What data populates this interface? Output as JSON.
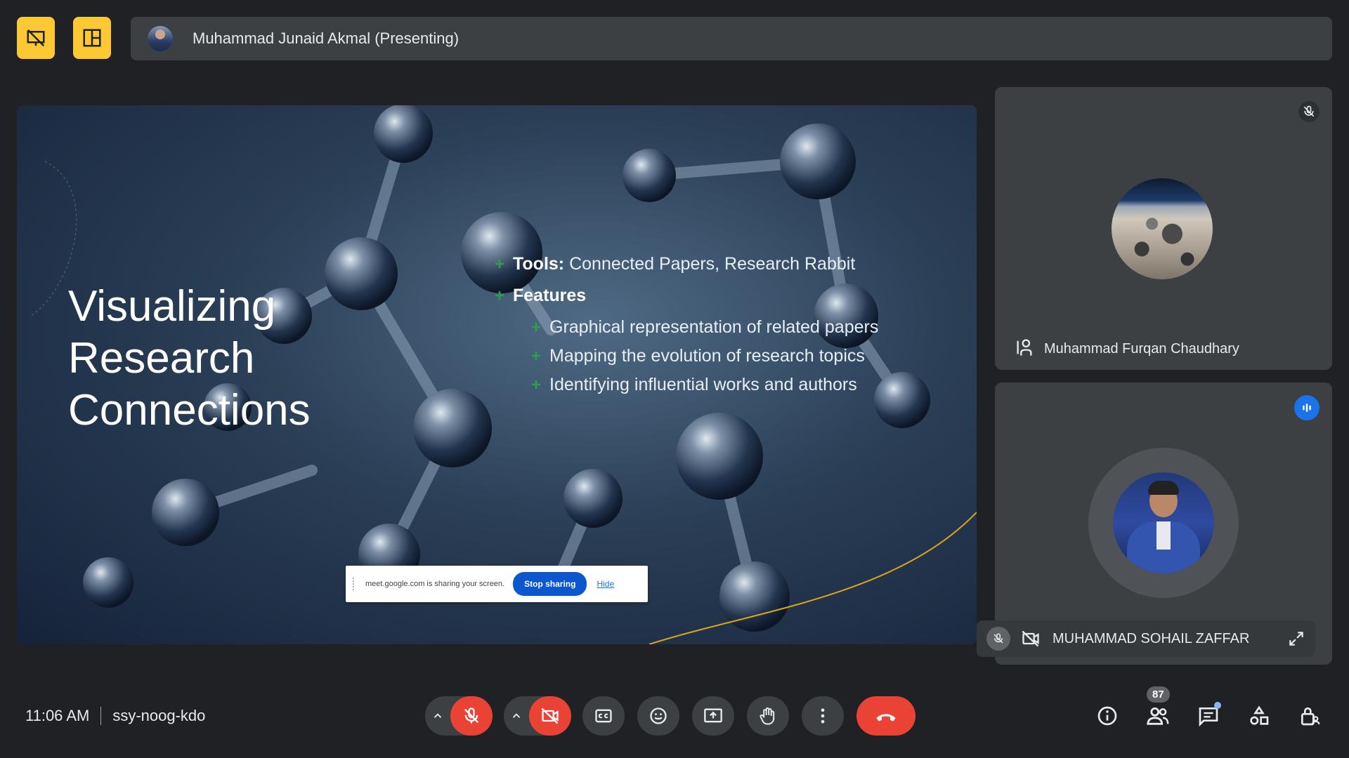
{
  "header": {
    "presenter_label": "Muhammad Junaid Akmal (Presenting)",
    "buttons": [
      "presentation-off-icon",
      "layout-icon"
    ]
  },
  "slide": {
    "title_line1": "Visualizing",
    "title_line2": "Research",
    "title_line3": "Connections",
    "tools_label": "Tools:",
    "tools_value": " Connected Papers, Research Rabbit",
    "features_label": "Features",
    "features": [
      "Graphical representation of related papers",
      "Mapping the evolution of research topics",
      "Identifying influential works and authors"
    ]
  },
  "share_banner": {
    "text": "meet.google.com is sharing your screen.",
    "stop_label": "Stop sharing",
    "hide_label": "Hide"
  },
  "participants": [
    {
      "name": "Muhammad Furqan Chaudhary",
      "muted": true
    },
    {
      "name": "MUHAMMAD SOHAIL ZAFFAR",
      "muted": true,
      "camera_off": true,
      "speaking": true
    }
  ],
  "footer": {
    "time": "11:06 AM",
    "meeting_code": "ssy-noog-kdo",
    "participant_count": "87"
  },
  "colors": {
    "background": "#202124",
    "accent_yellow": "#fcc934",
    "danger_red": "#ea4335",
    "primary_blue": "#0b57d0"
  }
}
